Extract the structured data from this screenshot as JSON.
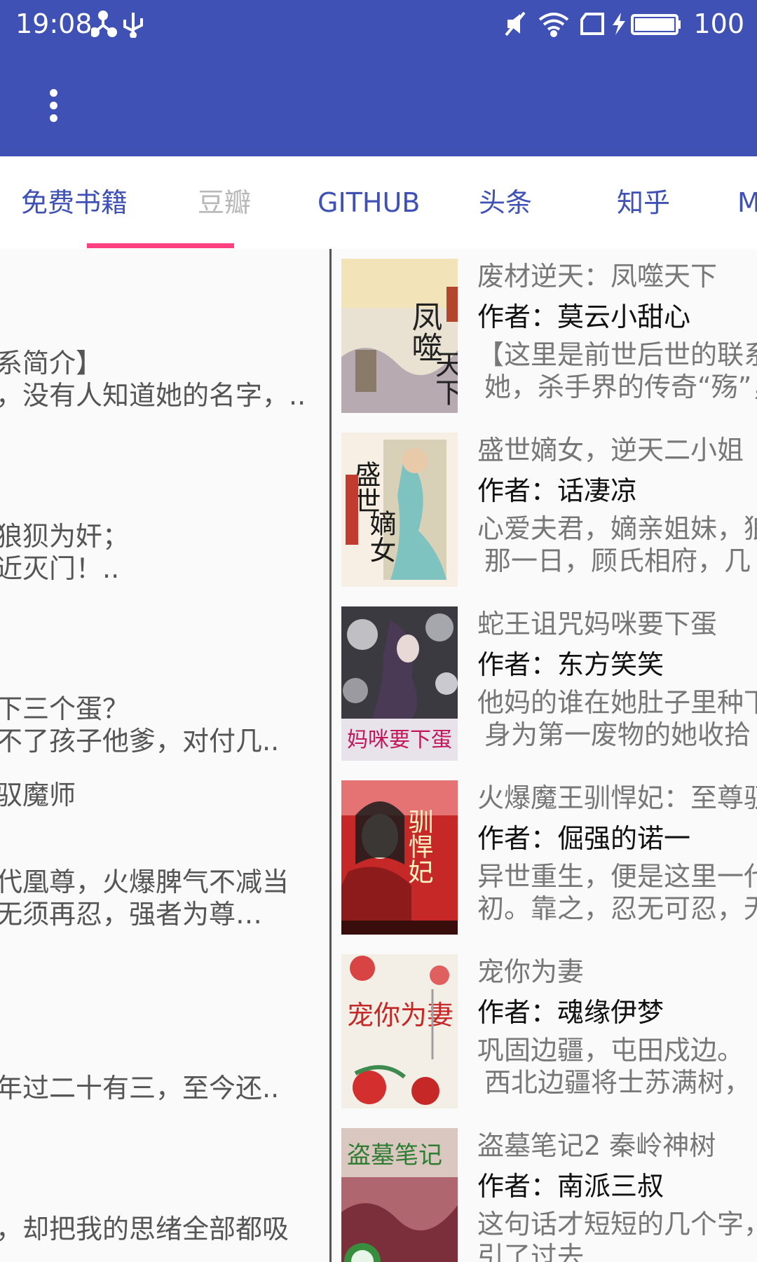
{
  "status_bar": {
    "time": "19:08",
    "battery": "100",
    "icons_left": [
      "network-share-icon",
      "usb-icon"
    ],
    "icons_right": [
      "mute-icon",
      "wifi-icon",
      "screen-cast-icon",
      "charging-icon",
      "battery-icon"
    ]
  },
  "app_bar": {
    "overflow_icon": "more-vert-icon",
    "color": "#3f51b5"
  },
  "tabs": [
    {
      "label": "免费书籍"
    },
    {
      "label": "豆瓣"
    },
    {
      "label": "GITHUB"
    },
    {
      "label": "头条"
    },
    {
      "label": "知乎"
    },
    {
      "label": "M"
    }
  ],
  "accent_color": "#ff4081",
  "left_list": [
    "系简介】",
    "，没有人知道她的名字，..",
    "狼狈为奸；",
    "近灭门！..",
    "下三个蛋？",
    "不了孩子他爹，对付几..",
    "驭魔师",
    "代凰尊，火爆脾气不减当",
    "无须再忍，强者为尊…",
    "年过二十有三，至今还..",
    "，却把我的思绪全部都吸"
  ],
  "books": [
    {
      "title": "废材逆天：凤噬天下",
      "author": "作者：莫云小甜心",
      "desc1": "【这里是前世后世的联系",
      "desc2": "她，杀手界的传奇“殇”，",
      "cover_text": "凤噬天下"
    },
    {
      "title": "盛世嫡女，逆天二小姐",
      "author": "作者：话凄凉",
      "desc1": "心爱夫君，嫡亲姐妹，狼",
      "desc2": "那一日，顾氏相府，几",
      "cover_text": "盛世嫡女"
    },
    {
      "title": "蛇王诅咒妈咪要下蛋",
      "author": "作者：东方笑笑",
      "desc1": "他妈的谁在她肚子里种下",
      "desc2": "身为第一废物的她收拾",
      "cover_text": "妈咪要下蛋"
    },
    {
      "title": "火爆魔王驯悍妃：至尊驭",
      "author": "作者：倔强的诺一",
      "desc1": "异世重生，便是这里一代",
      "desc2": "初。靠之，忍无可忍，无",
      "cover_text": "驯悍妃"
    },
    {
      "title": "宠你为妻",
      "author": "作者：魂缘伊梦",
      "desc1": "巩固边疆，屯田戍边。",
      "desc2": "西北边疆将士苏满树，",
      "cover_text": "宠你为妻"
    },
    {
      "title": "盗墓笔记2 秦岭神树",
      "author": "作者：南派三叔",
      "desc1": "这句话才短短的几个字，",
      "desc2": "引了过去",
      "cover_text": "盗墓笔记"
    }
  ]
}
